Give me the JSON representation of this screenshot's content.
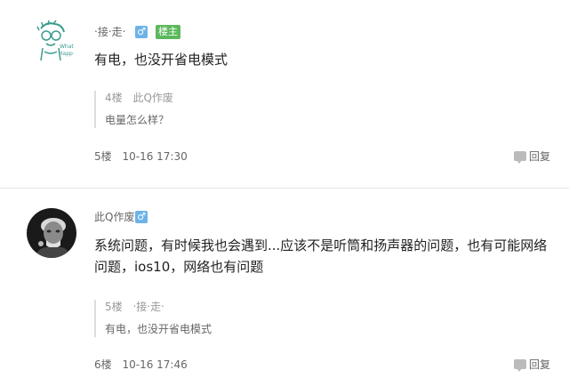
{
  "posts": [
    {
      "username": "‧接‧走‧",
      "avatar_icon": "cartoon-sketch-avatar",
      "gender": "♂",
      "host_badge": "楼主",
      "content": "有电，也没开省电模式",
      "quote": {
        "floor": "4楼",
        "user": "此Q作废",
        "text": "电量怎么样？"
      },
      "floor": "5楼",
      "time": "10-16 17:30",
      "reply_label": "回复"
    },
    {
      "username": "此Q作废",
      "avatar_icon": "bw-portrait-avatar",
      "gender": "♂",
      "content": "系统问题，有时候我也会遇到...应该不是听筒和扬声器的问题，也有可能网络问题，ios10，网络也有问题",
      "quote": {
        "floor": "5楼",
        "user": "‧接‧走‧",
        "text": "有电，也没开省电模式"
      },
      "floor": "6楼",
      "time": "10-16 17:46",
      "reply_label": "回复"
    }
  ],
  "colors": {
    "gender_badge": "#6cb3e8",
    "host_badge": "#5cb85c"
  }
}
